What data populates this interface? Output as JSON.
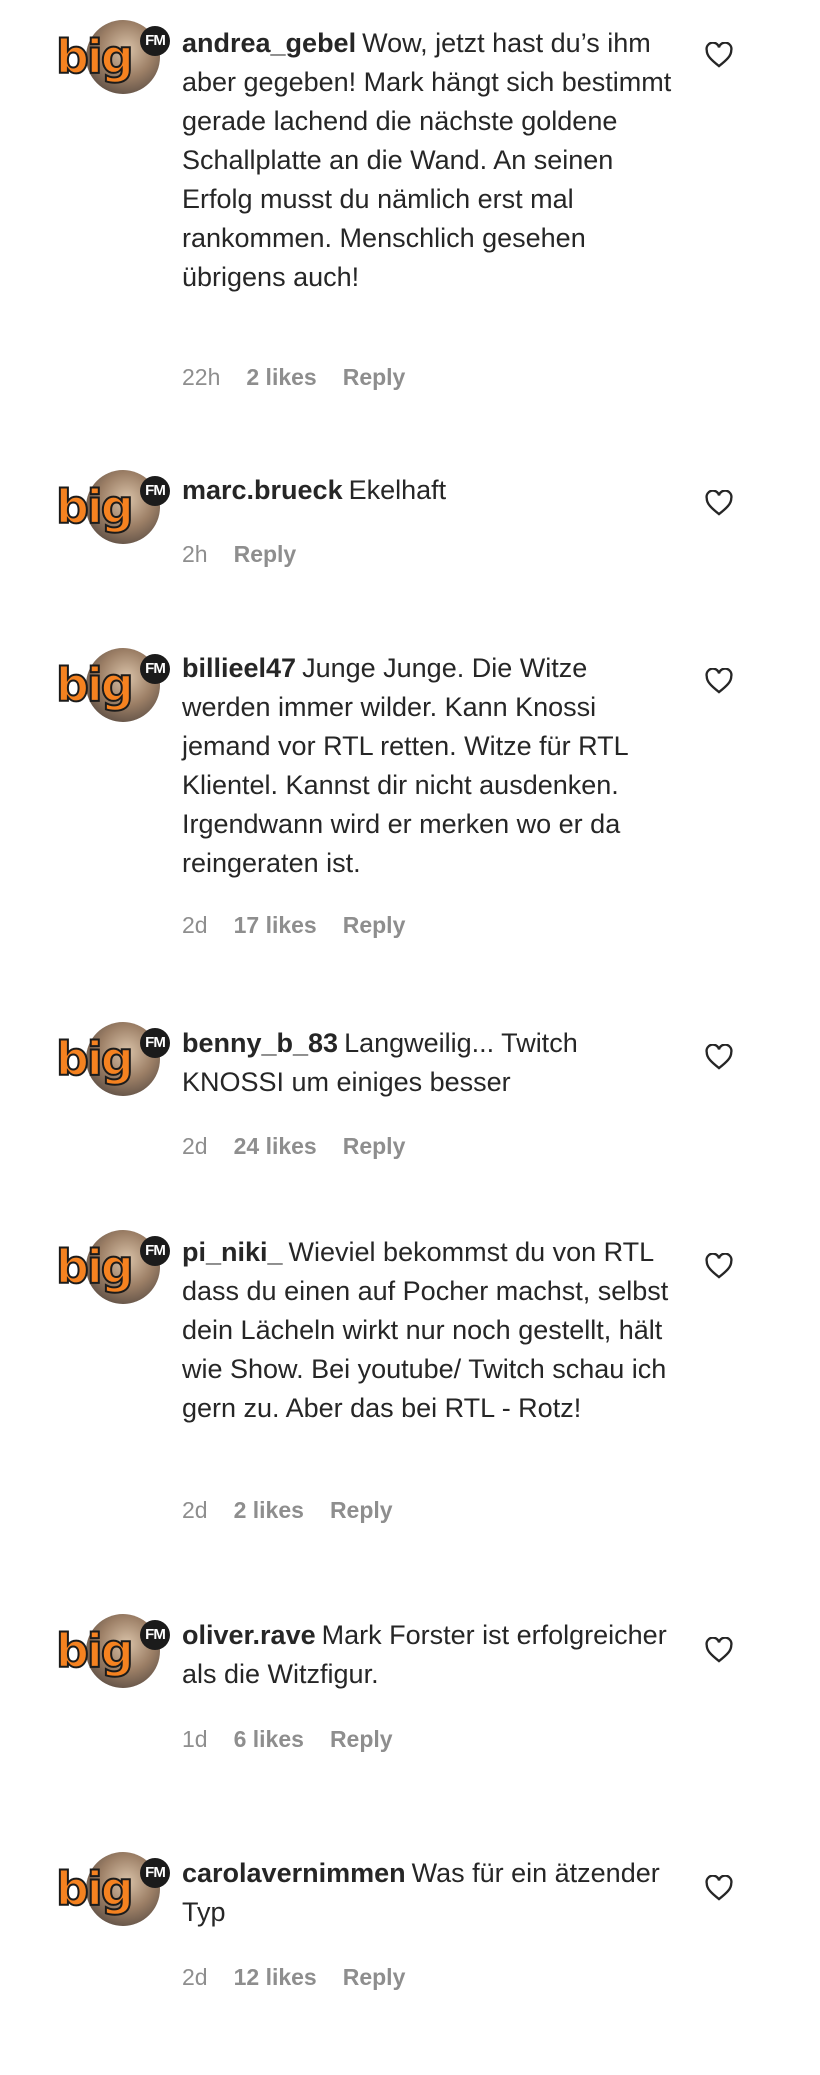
{
  "logo": {
    "big": "big",
    "fm": "FM"
  },
  "comments": [
    {
      "username": "andrea_gebel",
      "text": "Wow, jetzt hast du’s ihm aber gegeben! Mark hängt sich bestimmt gerade lachend die nächste goldene Schallplatte an die Wand. An seinen Erfolg musst du nämlich erst mal rankommen. Menschlich gesehen übrigens auch!",
      "time": "22h",
      "likes": "2 likes",
      "reply": "Reply"
    },
    {
      "username": "marc.brueck",
      "text": "Ekelhaft",
      "time": "2h",
      "likes": "",
      "reply": "Reply"
    },
    {
      "username": "billieel47",
      "text": "Junge Junge. Die Witze werden immer wilder. Kann Knossi jemand vor RTL retten. Witze für RTL Klientel. Kannst dir nicht ausdenken. Irgendwann wird er merken wo er da reingeraten ist.",
      "time": "2d",
      "likes": "17 likes",
      "reply": "Reply"
    },
    {
      "username": "benny_b_83",
      "text": "Langweilig... Twitch KNOSSI um einiges besser",
      "time": "2d",
      "likes": "24 likes",
      "reply": "Reply"
    },
    {
      "username": "pi_niki_",
      "text": "Wieviel bekommst du von RTL dass du einen auf Pocher machst, selbst dein Lächeln wirkt nur noch gestellt, hält wie Show. Bei youtube/ Twitch schau ich gern zu. Aber das bei RTL - Rotz!",
      "time": "2d",
      "likes": "2 likes",
      "reply": "Reply"
    },
    {
      "username": "oliver.rave",
      "text": "Mark Forster ist erfolgreicher als die Witzfigur.",
      "time": "1d",
      "likes": "6 likes",
      "reply": "Reply"
    },
    {
      "username": "carolavernimmen",
      "text": "Was für ein ätzender Typ",
      "time": "2d",
      "likes": "12 likes",
      "reply": "Reply"
    }
  ]
}
